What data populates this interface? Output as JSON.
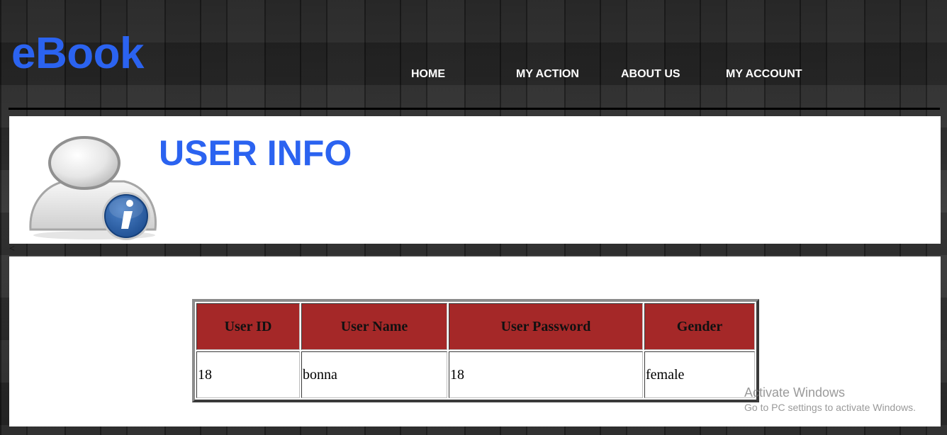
{
  "header": {
    "logo": "eBook",
    "nav": [
      "HOME",
      "MY ACTION",
      "ABOUT US",
      "MY ACCOUNT"
    ]
  },
  "banner": {
    "title": "USER INFO",
    "icon": "user-info-icon",
    "stray_text": "<"
  },
  "table": {
    "headers": [
      "User ID",
      "User Name",
      "User Password",
      "Gender"
    ],
    "rows": [
      [
        "18",
        "bonna",
        "18",
        "female"
      ]
    ]
  },
  "watermark": {
    "title": "Activate Windows",
    "subtitle": "Go to PC settings to activate Windows."
  },
  "colors": {
    "accent": "#2b63f0",
    "table_header": "#a52828"
  }
}
